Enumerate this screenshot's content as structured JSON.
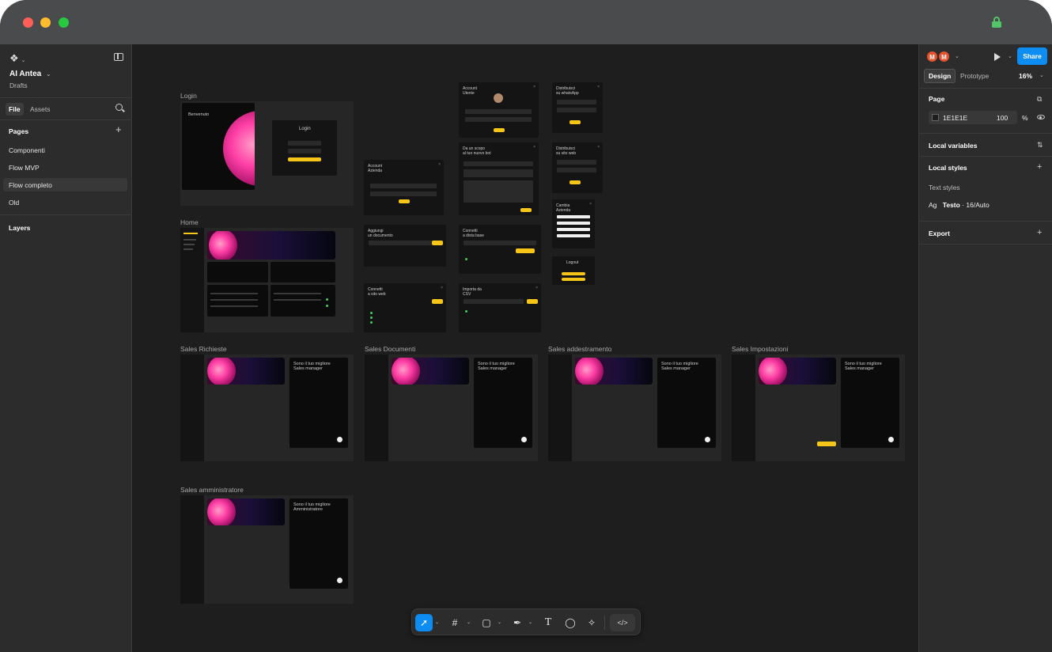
{
  "window": {
    "traffic_lights": [
      "close",
      "minimize",
      "zoom"
    ],
    "colors": {
      "close": "#ff5f57",
      "minimize": "#febc2e",
      "zoom": "#28c840",
      "lock": "#52c568"
    }
  },
  "left_panel": {
    "logo_icon": "figma-logo-icon",
    "file_title": "AI Antea",
    "file_subtitle": "Drafts",
    "tabs": [
      {
        "label": "File",
        "active": true
      },
      {
        "label": "Assets",
        "active": false
      }
    ],
    "pages_heading": "Pages",
    "pages": [
      {
        "label": "Componenti",
        "selected": false
      },
      {
        "label": "Flow MVP",
        "selected": false
      },
      {
        "label": "Flow completo",
        "selected": true
      },
      {
        "label": "Old",
        "selected": false
      }
    ],
    "layers_heading": "Layers"
  },
  "canvas": {
    "background": "#1e1e1e",
    "frames": {
      "login": "Login",
      "home": "Home",
      "sales_richieste": "Sales Richieste",
      "sales_documenti": "Sales Documenti",
      "sales_addestramento": "Sales addestramento",
      "sales_impostazioni": "Sales Impostazioni",
      "sales_amministratore": "Sales amministratore"
    },
    "mock_text": {
      "benvenuto": "Benvenuto",
      "login_card": "Login",
      "account_azienda": "Account\nAzienda",
      "account_utente": "Account\nUtente",
      "da_un_scopo": "Da un scopo\nal tuo nuovo bot",
      "distribuisci_whatsapp": "Distribuisci\nsu whatsApp",
      "distribuisci_web": "Distribuisci\nsu sito web",
      "cambia_azienda": "Cambia\nAzienda",
      "logout": "Logout",
      "aggiungi_documento": "Aggiungi\nun documento",
      "connetti_db": "Connetti\na dista base",
      "connetti_web": "Connetti\na sito web",
      "importa_csv": "Importa da\nCSV",
      "sales_manager": "Sono il tuo migliore\nSales manager",
      "amministratore": "Sono il tuo migliore\nAmministratore"
    }
  },
  "right_panel": {
    "avatars": [
      "M",
      "M"
    ],
    "share_label": "Share",
    "tabs": [
      {
        "label": "Design",
        "active": true
      },
      {
        "label": "Prototype",
        "active": false
      }
    ],
    "zoom": "16%",
    "page_heading": "Page",
    "page_color": "1E1E1E",
    "page_opacity": "100",
    "percent_sign": "%",
    "local_variables": "Local variables",
    "local_styles": "Local styles",
    "text_styles_label": "Text styles",
    "text_style_glyph": "Ag",
    "text_style_name": "Testo",
    "text_style_detail": " · 16/Auto",
    "export_heading": "Export"
  },
  "toolbar": {
    "tools": [
      "move-tool",
      "frame-tool",
      "shape-tool",
      "pen-tool",
      "text-tool",
      "comment-tool",
      "actions-tool",
      "dev-mode"
    ],
    "active_tool": "move-tool",
    "accent": "#0d8df2"
  }
}
